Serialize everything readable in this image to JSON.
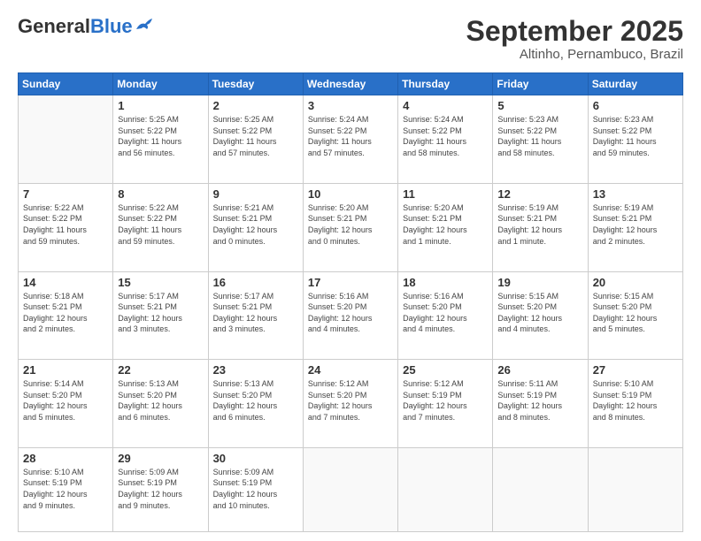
{
  "header": {
    "logo_general": "General",
    "logo_blue": "Blue",
    "month_title": "September 2025",
    "subtitle": "Altinho, Pernambuco, Brazil"
  },
  "days_of_week": [
    "Sunday",
    "Monday",
    "Tuesday",
    "Wednesday",
    "Thursday",
    "Friday",
    "Saturday"
  ],
  "weeks": [
    [
      {
        "day": "",
        "info": ""
      },
      {
        "day": "1",
        "info": "Sunrise: 5:25 AM\nSunset: 5:22 PM\nDaylight: 11 hours\nand 56 minutes."
      },
      {
        "day": "2",
        "info": "Sunrise: 5:25 AM\nSunset: 5:22 PM\nDaylight: 11 hours\nand 57 minutes."
      },
      {
        "day": "3",
        "info": "Sunrise: 5:24 AM\nSunset: 5:22 PM\nDaylight: 11 hours\nand 57 minutes."
      },
      {
        "day": "4",
        "info": "Sunrise: 5:24 AM\nSunset: 5:22 PM\nDaylight: 11 hours\nand 58 minutes."
      },
      {
        "day": "5",
        "info": "Sunrise: 5:23 AM\nSunset: 5:22 PM\nDaylight: 11 hours\nand 58 minutes."
      },
      {
        "day": "6",
        "info": "Sunrise: 5:23 AM\nSunset: 5:22 PM\nDaylight: 11 hours\nand 59 minutes."
      }
    ],
    [
      {
        "day": "7",
        "info": "Sunrise: 5:22 AM\nSunset: 5:22 PM\nDaylight: 11 hours\nand 59 minutes."
      },
      {
        "day": "8",
        "info": "Sunrise: 5:22 AM\nSunset: 5:22 PM\nDaylight: 11 hours\nand 59 minutes."
      },
      {
        "day": "9",
        "info": "Sunrise: 5:21 AM\nSunset: 5:21 PM\nDaylight: 12 hours\nand 0 minutes."
      },
      {
        "day": "10",
        "info": "Sunrise: 5:20 AM\nSunset: 5:21 PM\nDaylight: 12 hours\nand 0 minutes."
      },
      {
        "day": "11",
        "info": "Sunrise: 5:20 AM\nSunset: 5:21 PM\nDaylight: 12 hours\nand 1 minute."
      },
      {
        "day": "12",
        "info": "Sunrise: 5:19 AM\nSunset: 5:21 PM\nDaylight: 12 hours\nand 1 minute."
      },
      {
        "day": "13",
        "info": "Sunrise: 5:19 AM\nSunset: 5:21 PM\nDaylight: 12 hours\nand 2 minutes."
      }
    ],
    [
      {
        "day": "14",
        "info": "Sunrise: 5:18 AM\nSunset: 5:21 PM\nDaylight: 12 hours\nand 2 minutes."
      },
      {
        "day": "15",
        "info": "Sunrise: 5:17 AM\nSunset: 5:21 PM\nDaylight: 12 hours\nand 3 minutes."
      },
      {
        "day": "16",
        "info": "Sunrise: 5:17 AM\nSunset: 5:21 PM\nDaylight: 12 hours\nand 3 minutes."
      },
      {
        "day": "17",
        "info": "Sunrise: 5:16 AM\nSunset: 5:20 PM\nDaylight: 12 hours\nand 4 minutes."
      },
      {
        "day": "18",
        "info": "Sunrise: 5:16 AM\nSunset: 5:20 PM\nDaylight: 12 hours\nand 4 minutes."
      },
      {
        "day": "19",
        "info": "Sunrise: 5:15 AM\nSunset: 5:20 PM\nDaylight: 12 hours\nand 4 minutes."
      },
      {
        "day": "20",
        "info": "Sunrise: 5:15 AM\nSunset: 5:20 PM\nDaylight: 12 hours\nand 5 minutes."
      }
    ],
    [
      {
        "day": "21",
        "info": "Sunrise: 5:14 AM\nSunset: 5:20 PM\nDaylight: 12 hours\nand 5 minutes."
      },
      {
        "day": "22",
        "info": "Sunrise: 5:13 AM\nSunset: 5:20 PM\nDaylight: 12 hours\nand 6 minutes."
      },
      {
        "day": "23",
        "info": "Sunrise: 5:13 AM\nSunset: 5:20 PM\nDaylight: 12 hours\nand 6 minutes."
      },
      {
        "day": "24",
        "info": "Sunrise: 5:12 AM\nSunset: 5:20 PM\nDaylight: 12 hours\nand 7 minutes."
      },
      {
        "day": "25",
        "info": "Sunrise: 5:12 AM\nSunset: 5:19 PM\nDaylight: 12 hours\nand 7 minutes."
      },
      {
        "day": "26",
        "info": "Sunrise: 5:11 AM\nSunset: 5:19 PM\nDaylight: 12 hours\nand 8 minutes."
      },
      {
        "day": "27",
        "info": "Sunrise: 5:10 AM\nSunset: 5:19 PM\nDaylight: 12 hours\nand 8 minutes."
      }
    ],
    [
      {
        "day": "28",
        "info": "Sunrise: 5:10 AM\nSunset: 5:19 PM\nDaylight: 12 hours\nand 9 minutes."
      },
      {
        "day": "29",
        "info": "Sunrise: 5:09 AM\nSunset: 5:19 PM\nDaylight: 12 hours\nand 9 minutes."
      },
      {
        "day": "30",
        "info": "Sunrise: 5:09 AM\nSunset: 5:19 PM\nDaylight: 12 hours\nand 10 minutes."
      },
      {
        "day": "",
        "info": ""
      },
      {
        "day": "",
        "info": ""
      },
      {
        "day": "",
        "info": ""
      },
      {
        "day": "",
        "info": ""
      }
    ]
  ]
}
